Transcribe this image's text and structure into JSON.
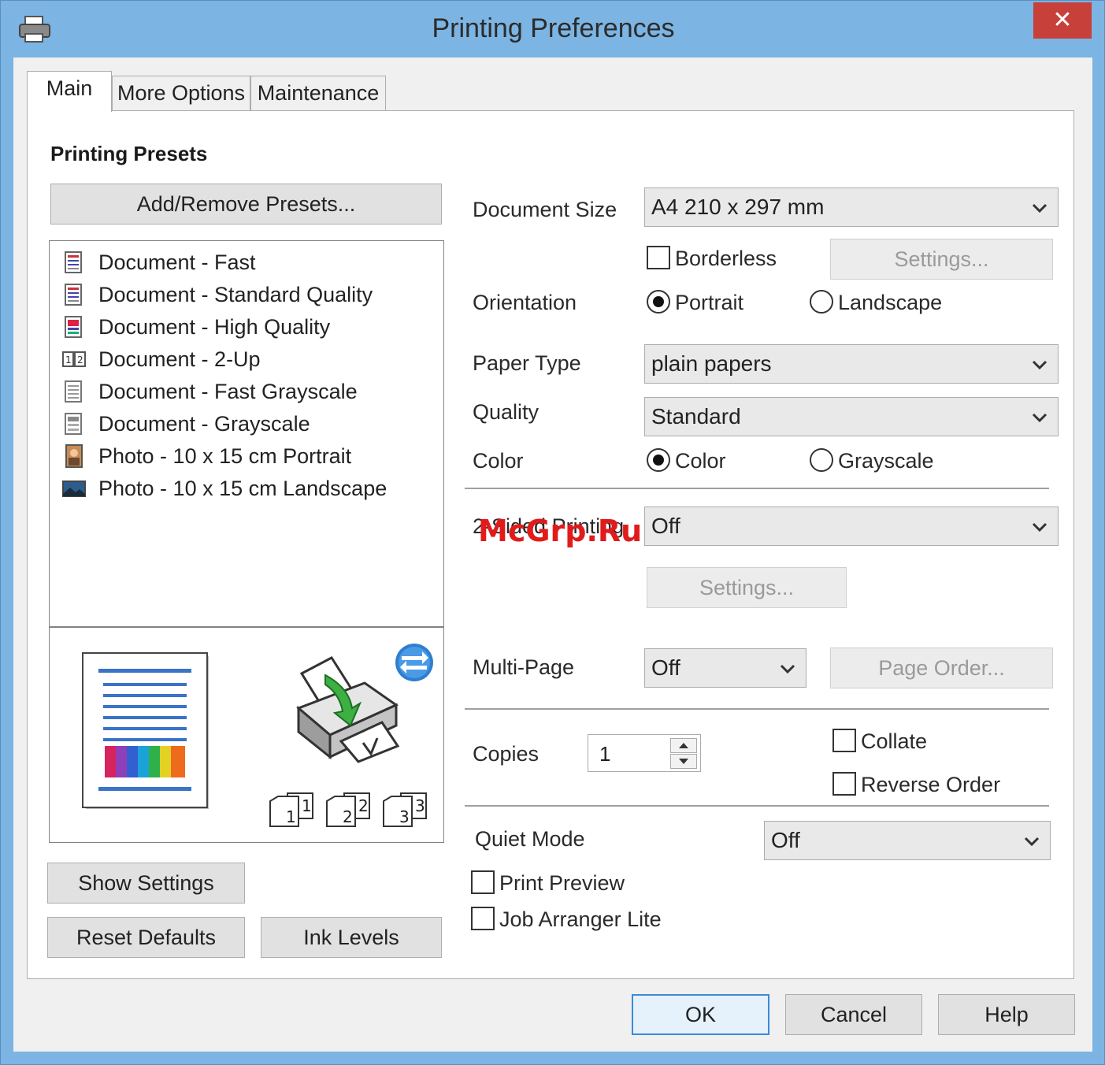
{
  "window": {
    "title": "Printing Preferences",
    "close_label": "✕"
  },
  "tabs": [
    {
      "label": "Main",
      "active": true
    },
    {
      "label": "More Options",
      "active": false
    },
    {
      "label": "Maintenance",
      "active": false
    }
  ],
  "presets": {
    "section_title": "Printing Presets",
    "add_remove_label": "Add/Remove Presets...",
    "items": [
      {
        "label": "Document - Fast",
        "icon": "document-icon"
      },
      {
        "label": "Document - Standard Quality",
        "icon": "document-icon"
      },
      {
        "label": "Document - High Quality",
        "icon": "document-hq-icon"
      },
      {
        "label": "Document - 2-Up",
        "icon": "two-up-icon"
      },
      {
        "label": "Document - Fast Grayscale",
        "icon": "grayscale-document-icon"
      },
      {
        "label": "Document - Grayscale",
        "icon": "grayscale-document-icon"
      },
      {
        "label": "Photo - 10 x 15 cm Portrait",
        "icon": "photo-portrait-icon"
      },
      {
        "label": "Photo - 10 x 15 cm Landscape",
        "icon": "photo-landscape-icon"
      }
    ]
  },
  "preview": {
    "copy_labels": [
      "1",
      "1",
      "2",
      "2",
      "3",
      "3"
    ]
  },
  "left_buttons": {
    "show_settings": "Show Settings",
    "reset_defaults": "Reset Defaults",
    "ink_levels": "Ink Levels"
  },
  "settings": {
    "document_size": {
      "label": "Document Size",
      "value": "A4 210 x 297 mm"
    },
    "borderless": {
      "label": "Borderless",
      "checked": false,
      "settings_label": "Settings..."
    },
    "orientation": {
      "label": "Orientation",
      "portrait": "Portrait",
      "landscape": "Landscape",
      "selected": "Portrait"
    },
    "paper_type": {
      "label": "Paper Type",
      "value": "plain papers"
    },
    "quality": {
      "label": "Quality",
      "value": "Standard"
    },
    "color": {
      "label": "Color",
      "color": "Color",
      "grayscale": "Grayscale",
      "selected": "Color"
    },
    "two_sided": {
      "label": "2-Sided Printing",
      "value": "Off",
      "settings_label": "Settings..."
    },
    "multi_page": {
      "label": "Multi-Page",
      "value": "Off",
      "page_order_label": "Page Order..."
    },
    "copies": {
      "label": "Copies",
      "value": "1"
    },
    "collate": {
      "label": "Collate",
      "checked": false
    },
    "reverse_order": {
      "label": "Reverse Order",
      "checked": false
    },
    "quiet_mode": {
      "label": "Quiet Mode",
      "value": "Off"
    },
    "print_preview": {
      "label": "Print Preview",
      "checked": false
    },
    "job_arranger": {
      "label": "Job Arranger Lite",
      "checked": false
    }
  },
  "footer": {
    "ok": "OK",
    "cancel": "Cancel",
    "help": "Help"
  },
  "watermark": "McGrp.Ru",
  "colors": {
    "titlebar": "#7cb4e3",
    "close": "#c7403a",
    "accent": "#3c8ad8"
  }
}
